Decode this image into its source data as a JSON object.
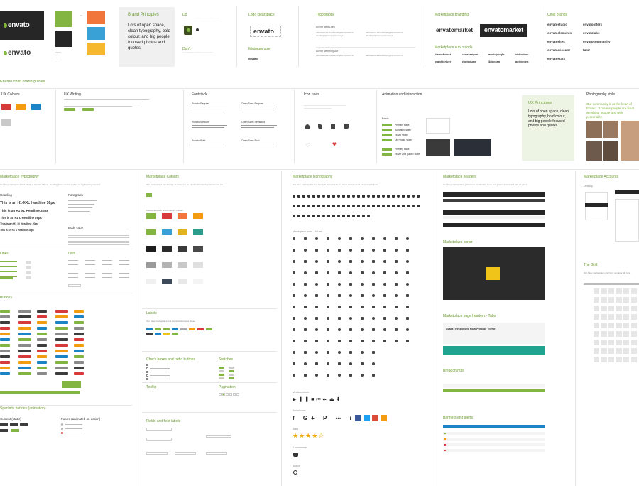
{
  "colors": {
    "green": "#82b541",
    "dark": "#262626",
    "red": "#d63a3a",
    "orange": "#f39c12",
    "blue": "#1b84c7",
    "yellow": "#f0c419",
    "grey": "#9a9a9a",
    "lightgrey": "#e8e8e8",
    "navy": "#3d4a5a"
  },
  "top": {
    "logo1": "envato",
    "logo2": "envato",
    "principles_title": "Brand Principles",
    "principles_text": "Lots of open space, clean typography, bold colour, and big people focused photos and quotes.",
    "do": "Do",
    "dont": "Don't",
    "logo_clearspace": "Logo clearspace",
    "logo3": "envato",
    "min_size": "Minimum size",
    "min_logo": "envato",
    "typography": "Typography",
    "font_a": "Avenir Next Light",
    "font_b": "Avenir Next Regular",
    "marketplace_branding": "Marketplace branding",
    "mk1": "envatomarket",
    "mk2": "envatomarket",
    "marketplace_sub": "Marketplace sub brands",
    "sub_brands": [
      "themeforest",
      "codecanyon",
      "audiojungle",
      "videohive",
      "graphicriver",
      "photodune",
      "3docean",
      "activeden"
    ],
    "child_brands": "Child brands",
    "children": [
      "envatostudio",
      "envatooffers",
      "envatoelements",
      "envatolabs",
      "envatosites",
      "envatocommunity",
      "envatoaccount",
      "tuts+",
      "envatostats"
    ]
  },
  "section2_title": "Envato child brand guides",
  "s2": {
    "ux_colours": "UX Colours",
    "ux_writing": "UX Writing",
    "fontstack": "Fontstack",
    "icon_rules": "Icon rules",
    "animation": "Animation and interaction",
    "ux_principles": "UX Principles",
    "ux_principles_text": "Lots of open space, clean typography, bold colour, and big people focused photos and quotes.",
    "photo_style": "Photography style",
    "photo_text": "Our community is at the heart of Envato. It means people are what we show, people and with personality.",
    "font_items": [
      "Roboto Regular",
      "Roboto Medium",
      "Roboto Bold",
      "Open Sans Regular",
      "Open Sans Semibold",
      "Open Sans Bold"
    ],
    "basic": "Basic",
    "states": [
      "Primary state",
      "Activated state",
      "Hover state",
      "Up Phase state"
    ],
    "states2": [
      "Primary state",
      "Hover and pause state"
    ]
  },
  "s3": {
    "mp_typography": "Marketplace Typography",
    "heading": "Heading",
    "paragraph": "Paragraph",
    "h1": "This is an H1-XXL Headline 36px",
    "h2": "This is an H1 XL Headline 32px",
    "h3": "This is an H1 L Headline 26px",
    "h4": "This is an H1 M Headline 20px",
    "h5": "This is an H1 S Headline 18px",
    "body_copy": "Body copy",
    "links": "Links",
    "lists": "Lists",
    "buttons": "Buttons",
    "specialty": "Specialty buttons (animation)",
    "current": "Current (static)",
    "future": "Future (animated on action)",
    "mp_colours": "Marketplace Colours",
    "labels": "Labels",
    "checkboxes": "Check boxes and radio buttons",
    "switches": "Switches",
    "tooltip": "Tooltip",
    "pagination": "Pagination",
    "fields": "Fields and field labels",
    "mp_iconography": "Marketplace Iconography",
    "icons_full": "Marketplace icons - full set",
    "media": "Media controls",
    "social": "Social icons",
    "stars": "Stars",
    "ecommerce": "E-commerce",
    "search": "Search",
    "mp_headers": "Marketplace headers",
    "mp_footer": "Marketplace footer",
    "page_headers": "Marketplace page headers - Tabs",
    "page_header_title": "Avada | Responsive Multi-Purpose Theme",
    "breadcrumbs": "Breadcrumbs",
    "banners": "Banners and alerts",
    "accounts": "Marketplace Accounts",
    "desktop": "Desktop",
    "the_grid": "The Grid"
  }
}
